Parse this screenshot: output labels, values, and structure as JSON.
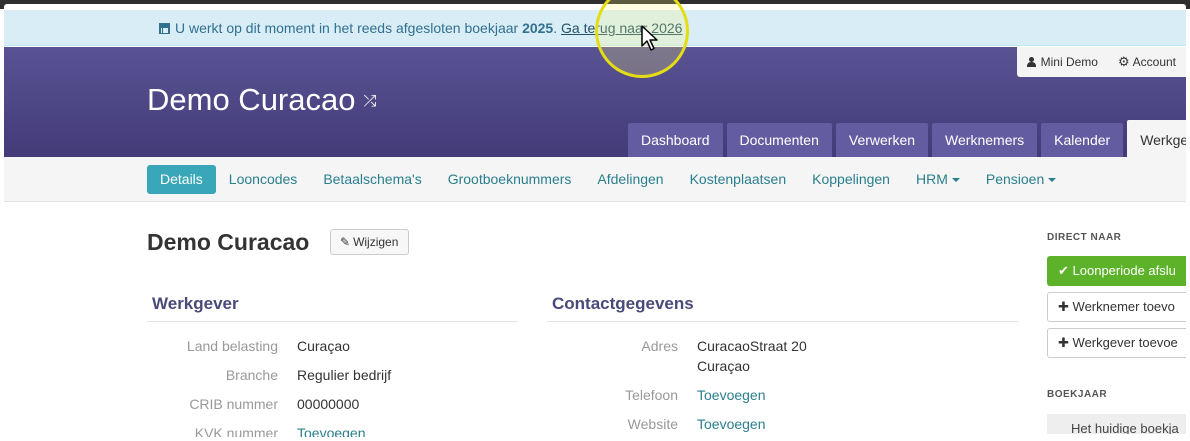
{
  "notice": {
    "text_before": "U werkt op dit moment in het reeds afgesloten boekjaar",
    "year": "2025",
    "separator": ". ",
    "link": "Ga terug naar 2026"
  },
  "header": {
    "brand": "Demo Curacao",
    "user_name": "Mini Demo",
    "account_label": "Account"
  },
  "main_tabs": [
    {
      "label": "Dashboard"
    },
    {
      "label": "Documenten"
    },
    {
      "label": "Verwerken"
    },
    {
      "label": "Werknemers"
    },
    {
      "label": "Kalender"
    },
    {
      "label": "Werkgever",
      "active": true
    }
  ],
  "sub_nav": [
    {
      "label": "Details",
      "active": true
    },
    {
      "label": "Looncodes"
    },
    {
      "label": "Betaalschema's"
    },
    {
      "label": "Grootboeknummers"
    },
    {
      "label": "Afdelingen"
    },
    {
      "label": "Kostenplaatsen"
    },
    {
      "label": "Koppelingen"
    },
    {
      "label": "HRM",
      "dropdown": true
    },
    {
      "label": "Pensioen",
      "dropdown": true
    }
  ],
  "page": {
    "title": "Demo Curacao",
    "edit_label": "Wijzigen"
  },
  "werkgever": {
    "heading": "Werkgever",
    "rows": [
      {
        "label": "Land belasting",
        "value": "Curaçao"
      },
      {
        "label": "Branche",
        "value": "Regulier bedrijf"
      },
      {
        "label": "CRIB nummer",
        "value": "00000000"
      },
      {
        "label": "KVK nummer",
        "value": "Toevoegen"
      }
    ]
  },
  "contact": {
    "heading": "Contactgegevens",
    "adres_label": "Adres",
    "adres_line1": "CuracaoStraat 20",
    "adres_line2": "Curaçao",
    "telefoon_label": "Telefoon",
    "telefoon_value": "Toevoegen",
    "website_label": "Website",
    "website_value": "Toevoegen"
  },
  "aside": {
    "heading": "DIRECT NAAR",
    "btn_loonperiode": "Loonperiode afslu",
    "btn_werknemer": "Werknemer toevo",
    "btn_werkgever": "Werkgever toevoe",
    "boekjaar_heading": "BOEKJAAR",
    "boekjaar_item": "Het huidige boekja"
  },
  "colors": {
    "header": "#4e4789",
    "tab": "#645ca0",
    "notice_bg": "#d9edf7",
    "accent": "#3aa6b9",
    "success": "#5cb32a"
  }
}
